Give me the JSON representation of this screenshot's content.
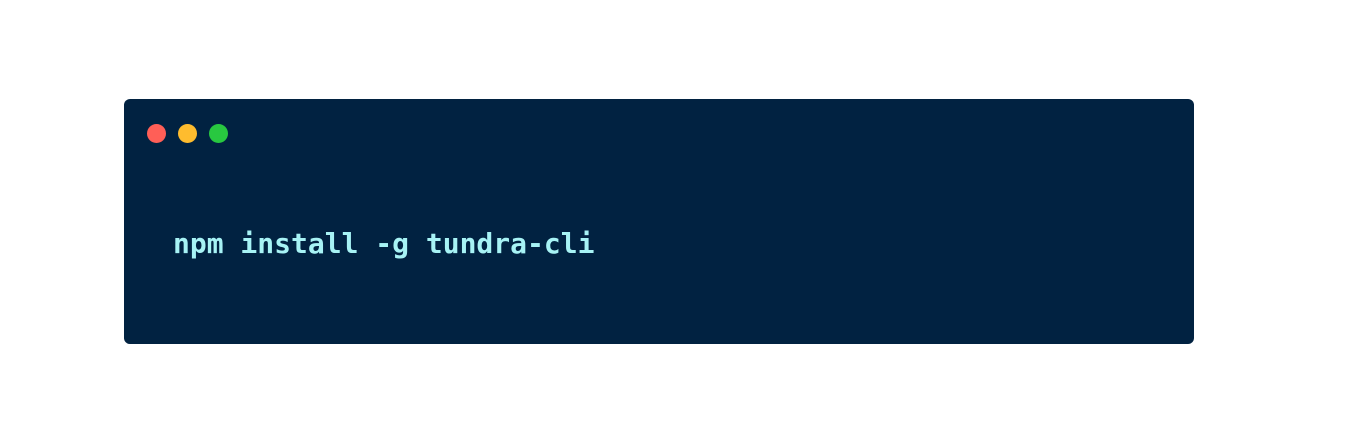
{
  "terminal": {
    "background": "#012241",
    "command": "npm install -g tundra-cli",
    "command_color": "#A7F3F5",
    "window_controls": [
      {
        "icon": "close-dot-icon",
        "color": "#FF5F57"
      },
      {
        "icon": "minimize-dot-icon",
        "color": "#FEBC2E"
      },
      {
        "icon": "maximize-dot-icon",
        "color": "#28C840"
      }
    ]
  }
}
